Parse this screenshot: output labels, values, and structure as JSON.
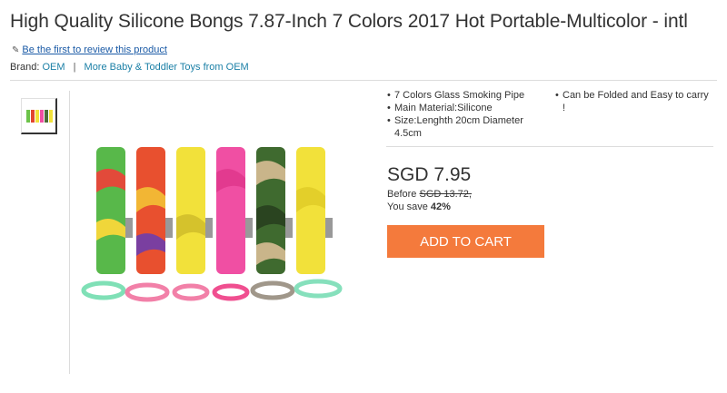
{
  "product": {
    "title": "High Quality Silicone Bongs 7.87-Inch 7 Colors 2017 Hot Portable-Multicolor - intl",
    "review_link": "Be the first to review this product",
    "brand_label": "Brand:",
    "brand_name": "OEM",
    "separator": "|",
    "more_link": "More Baby & Toddler Toys from OEM"
  },
  "features": {
    "left": [
      "7 Colors Glass Smoking Pipe",
      "Main Material:Silicone",
      "Size:Lenghth 20cm Diameter 4.5cm"
    ],
    "right": [
      "Can be Folded and Easy to carry !"
    ]
  },
  "pricing": {
    "price": "SGD 7.95",
    "before_label": "Before",
    "before_price": "SGD 13.72,",
    "save_label": "You save",
    "save_percent": "42%"
  },
  "actions": {
    "add_to_cart": "ADD TO CART"
  },
  "colors": {
    "accent": "#f47a3c",
    "link": "#1a7fa6"
  },
  "icons": {
    "review": "pencil-icon"
  }
}
